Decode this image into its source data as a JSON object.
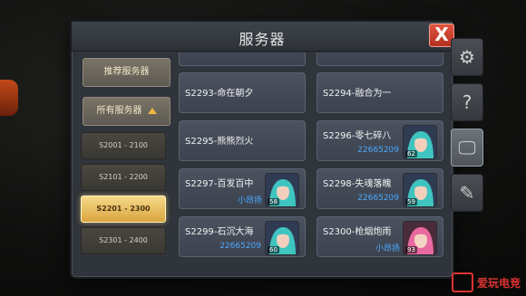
{
  "dialog": {
    "title": "服务器",
    "close_label": "X"
  },
  "categories": {
    "recommended": "推荐服务器",
    "all": "所有服务器"
  },
  "ranges": [
    {
      "label": "S2001 - 2100",
      "selected": false
    },
    {
      "label": "S2101 - 2200",
      "selected": false
    },
    {
      "label": "S2201 - 2300",
      "selected": true
    },
    {
      "label": "S2301 - 2400",
      "selected": false
    }
  ],
  "servers": [
    {
      "name": "S2293-命在朝夕",
      "sub": "",
      "level": ""
    },
    {
      "name": "S2294-融合为一",
      "sub": "",
      "level": ""
    },
    {
      "name": "S2295-熊熊烈火",
      "sub": "",
      "level": ""
    },
    {
      "name": "S2296-零七碎八",
      "sub": "22665209",
      "level": "62"
    },
    {
      "name": "S2297-百发百中",
      "sub": "小昂扬",
      "level": "58"
    },
    {
      "name": "S2298-失魂落魄",
      "sub": "22665209",
      "level": "59"
    },
    {
      "name": "S2299-石沉大海",
      "sub": "22665209",
      "level": "60"
    },
    {
      "name": "S2300-枪烟炮雨",
      "sub": "小昂扬",
      "level": "93"
    }
  ],
  "side_tabs": [
    {
      "icon": "gear-icon",
      "glyph": "⚙"
    },
    {
      "icon": "help-icon",
      "glyph": "?"
    },
    {
      "icon": "monitor-icon",
      "glyph": "🖵"
    },
    {
      "icon": "edit-icon",
      "glyph": "✎"
    }
  ],
  "watermark": {
    "text": "爱玩电竞"
  },
  "colors": {
    "accent_gold": "#d9a53e",
    "close_red": "#c63a26",
    "id_blue": "#4aa8ff"
  }
}
